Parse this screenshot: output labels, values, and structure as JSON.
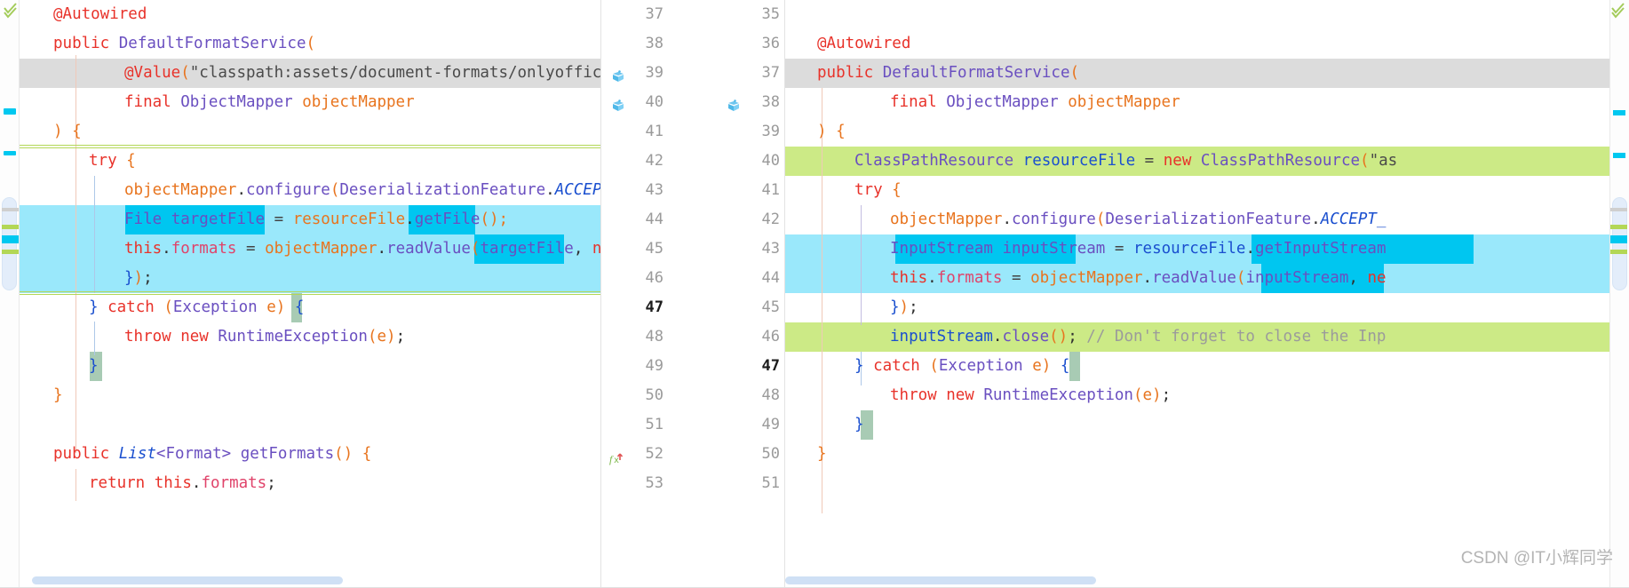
{
  "app": {
    "kind": "ide-diff-viewer",
    "watermark": "CSDN @IT小辉同学"
  },
  "colors": {
    "added": "#ccea86",
    "modified": "#9ae8fb",
    "modified_strong": "#00c6f0",
    "current_line": "#dcdcdc",
    "diff_border": "#b3d756",
    "gutter_text": "#9a9a9a",
    "keyword": "#e8322a",
    "type": "#6a4fc0",
    "field": "#e0436a",
    "variable": "#e8741e",
    "static_field": "#1a4fcf",
    "comment": "#9b9b9b"
  },
  "left_pane": {
    "name": "left-editor",
    "line_numbers": [
      "37",
      "38",
      "39",
      "40",
      "41",
      "42",
      "43",
      "44",
      "45",
      "46",
      "47",
      "48",
      "49",
      "50",
      "51",
      "52",
      "53"
    ],
    "bold_line": "47",
    "gutter_icons": {
      "39": "bean-icon",
      "40": "bean-icon",
      "52": "override-method-icon"
    },
    "lines": [
      {
        "n": "37",
        "indent": 1,
        "state": "normal",
        "text": "@Autowired"
      },
      {
        "n": "38",
        "indent": 1,
        "state": "normal",
        "text": "public DefaultFormatService("
      },
      {
        "n": "39",
        "indent": 3,
        "state": "current",
        "text": "@Value(\"classpath:assets/document-formats/onlyoffice"
      },
      {
        "n": "40",
        "indent": 3,
        "state": "normal",
        "text": "final ObjectMapper objectMapper"
      },
      {
        "n": "41",
        "indent": 1,
        "state": "normal",
        "text": ") {"
      },
      {
        "n": "42",
        "indent": 2,
        "state": "normal",
        "text": "try {"
      },
      {
        "n": "43",
        "indent": 3,
        "state": "normal",
        "text": "objectMapper.configure(DeserializationFeature.ACCEPT"
      },
      {
        "n": "44",
        "indent": 3,
        "state": "modified",
        "text": "File targetFile = resourceFile.getFile();"
      },
      {
        "n": "45",
        "indent": 3,
        "state": "modified",
        "text": "this.formats = objectMapper.readValue(targetFile, ne"
      },
      {
        "n": "46",
        "indent": 3,
        "state": "modified-light",
        "text": "});"
      },
      {
        "n": "47",
        "indent": 2,
        "state": "normal",
        "text": "} catch (Exception e) {"
      },
      {
        "n": "48",
        "indent": 3,
        "state": "normal",
        "text": "throw new RuntimeException(e);"
      },
      {
        "n": "49",
        "indent": 2,
        "state": "normal",
        "text": "}"
      },
      {
        "n": "50",
        "indent": 1,
        "state": "normal",
        "text": "}"
      },
      {
        "n": "51",
        "indent": 0,
        "state": "normal",
        "text": ""
      },
      {
        "n": "52",
        "indent": 1,
        "state": "normal",
        "text": "public List<Format> getFormats() {"
      },
      {
        "n": "53",
        "indent": 2,
        "state": "normal",
        "text": "return this.formats;"
      }
    ]
  },
  "right_pane": {
    "name": "right-editor",
    "line_numbers": [
      "35",
      "36",
      "37",
      "38",
      "39",
      "40",
      "41",
      "42",
      "43",
      "44",
      "45",
      "46",
      "47",
      "48",
      "49",
      "50",
      "51"
    ],
    "bold_line": "49",
    "gutter_icons": {
      "38": "bean-icon"
    },
    "lines": [
      {
        "n": "35",
        "indent": 0,
        "state": "normal",
        "text": ""
      },
      {
        "n": "36",
        "indent": 1,
        "state": "normal",
        "text": "@Autowired"
      },
      {
        "n": "37",
        "indent": 1,
        "state": "current",
        "text": "public DefaultFormatService("
      },
      {
        "n": "38",
        "indent": 3,
        "state": "normal",
        "text": "final ObjectMapper objectMapper"
      },
      {
        "n": "39",
        "indent": 1,
        "state": "normal",
        "text": ") {"
      },
      {
        "n": "40",
        "indent": 3,
        "state": "added",
        "text": "ClassPathResource resourceFile = new ClassPathResource(\"as"
      },
      {
        "n": "41",
        "indent": 2,
        "state": "normal",
        "text": "try {"
      },
      {
        "n": "42",
        "indent": 3,
        "state": "normal",
        "text": "objectMapper.configure(DeserializationFeature.ACCEPT_"
      },
      {
        "n": "43",
        "indent": 3,
        "state": "modified",
        "text": "InputStream inputStream = resourceFile.getInputStream"
      },
      {
        "n": "44",
        "indent": 3,
        "state": "modified",
        "text": "this.formats = objectMapper.readValue(inputStream, ne"
      },
      {
        "n": "45",
        "indent": 3,
        "state": "normal",
        "text": "});"
      },
      {
        "n": "46",
        "indent": 3,
        "state": "added",
        "text": "inputStream.close(); // Don't forget to close the Inp"
      },
      {
        "n": "47",
        "indent": 2,
        "state": "normal",
        "text": "} catch (Exception e) {"
      },
      {
        "n": "48",
        "indent": 3,
        "state": "normal",
        "text": "throw new RuntimeException(e);"
      },
      {
        "n": "49",
        "indent": 2,
        "state": "normal",
        "text": "}"
      },
      {
        "n": "50",
        "indent": 1,
        "state": "normal",
        "text": "}"
      },
      {
        "n": "51",
        "indent": 0,
        "state": "normal",
        "text": ""
      }
    ]
  },
  "scrollbars": {
    "left_horizontal_visible": true,
    "right_horizontal_visible": true,
    "left_vertical_visible": true,
    "right_vertical_visible": true
  }
}
